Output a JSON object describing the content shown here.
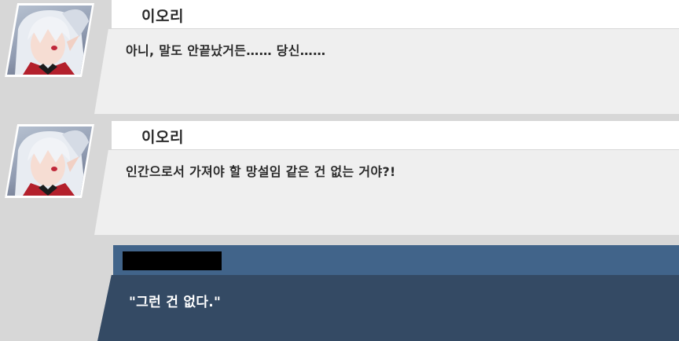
{
  "messages": [
    {
      "speaker": "이오리",
      "text": "아니, 말도 안끝났거든…… 당신……",
      "avatar_icon": "character-portrait-silver-hair"
    },
    {
      "speaker": "이오리",
      "text": "인간으로서 가져야 할 망설임 같은 건 없는 거야?!",
      "avatar_icon": "character-portrait-silver-hair"
    }
  ],
  "player_reply": {
    "text": "\"그런 건 없다.\"",
    "name_redacted": true
  },
  "colors": {
    "background": "#d7d7d7",
    "name_bar": "#ffffff",
    "text_box": "#efefef",
    "player_header": "#41648a",
    "player_body": "#344a64"
  }
}
